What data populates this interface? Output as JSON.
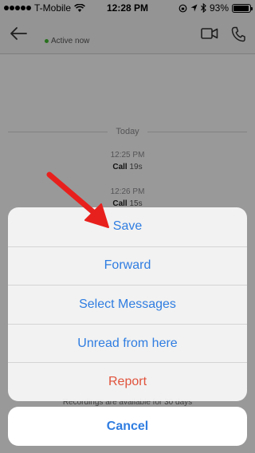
{
  "status_bar": {
    "carrier": "T-Mobile",
    "time": "12:28 PM",
    "battery_percent": "93%",
    "battery_level": 0.93
  },
  "chat_header": {
    "active_status": "Active now"
  },
  "chat": {
    "day_label": "Today",
    "calls": [
      {
        "time": "12:25 PM",
        "label": "Call",
        "duration": "19s"
      },
      {
        "time": "12:26 PM",
        "label": "Call",
        "duration": "15s"
      }
    ],
    "recording_note": "Recordings are available for 30 days"
  },
  "action_sheet": {
    "items": [
      {
        "label": "Save"
      },
      {
        "label": "Forward"
      },
      {
        "label": "Select Messages"
      },
      {
        "label": "Unread from here"
      },
      {
        "label": "Report"
      }
    ],
    "cancel_label": "Cancel"
  },
  "colors": {
    "action_blue": "#2f7de1",
    "destructive_red": "#e0533c",
    "active_green": "#44bd32",
    "annotation_arrow": "#e8201d"
  }
}
